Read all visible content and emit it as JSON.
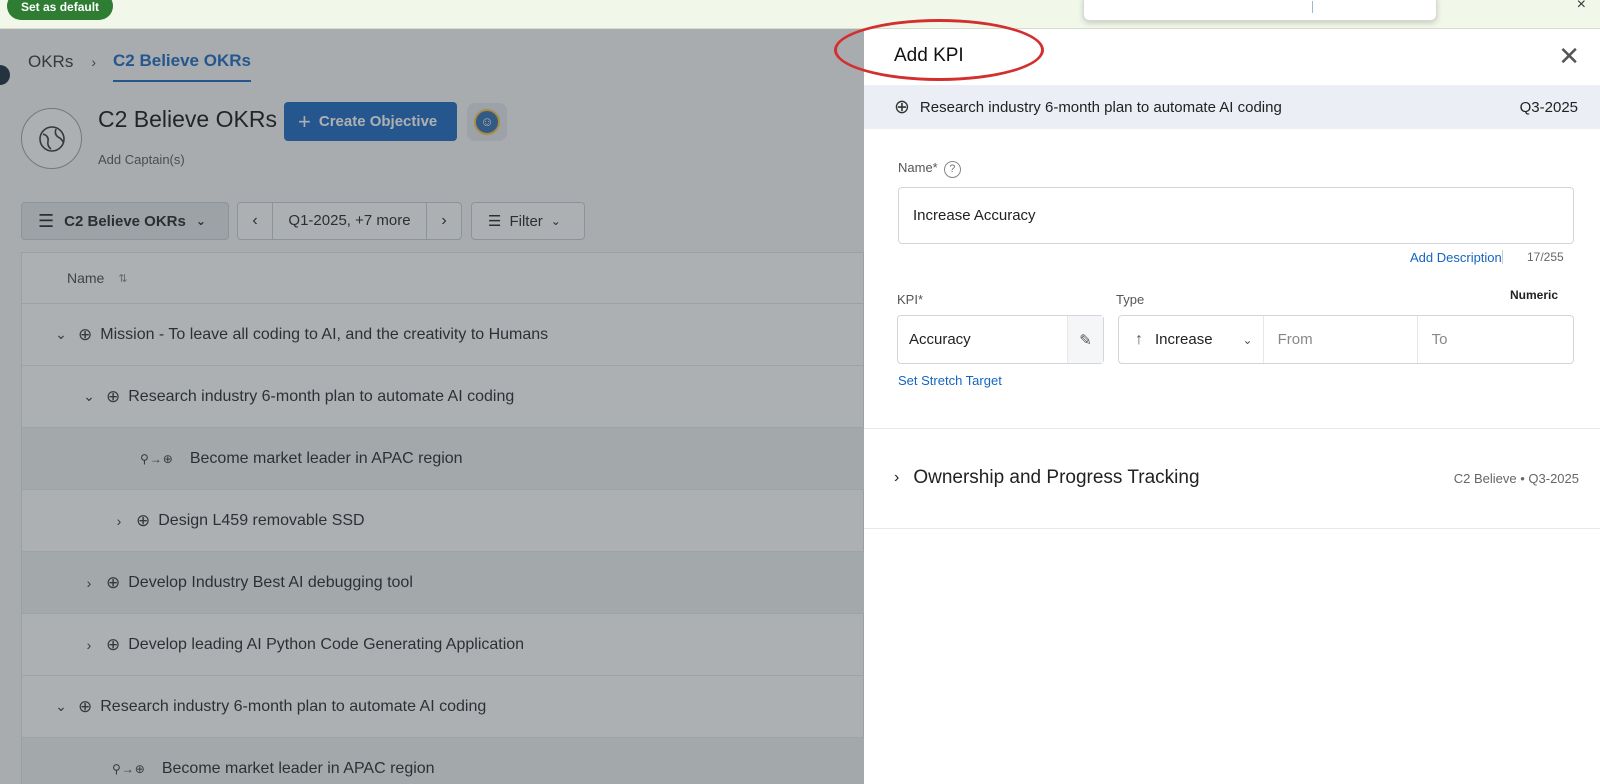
{
  "banner": {
    "default_button": "Set as default",
    "close_glyph": "×"
  },
  "breadcrumb": {
    "root": "OKRs",
    "separator": "›",
    "current": "C2 Believe OKRs"
  },
  "team": {
    "title": "C2 Believe OKRs",
    "create_button": "Create Objective",
    "create_icon": "plus-icon",
    "add_captains": "Add Captain(s)",
    "avatar_icon": "globe-icon"
  },
  "toolbar": {
    "okr_selector": "C2 Believe OKRs",
    "period": "Q1-2025, +7 more",
    "filter": "Filter"
  },
  "table": {
    "column_name": "Name",
    "rows": [
      {
        "text": "Mission - To leave all coding to AI, and the creativity to Humans",
        "caret": "⌄",
        "kind": "objective"
      },
      {
        "text": "Research industry 6-month plan to automate AI coding",
        "caret": "⌄",
        "kind": "objective"
      },
      {
        "text": "Become market leader in APAC region",
        "caret": "",
        "kind": "key-result"
      },
      {
        "text": "Design L459 removable SSD",
        "caret": "›",
        "kind": "objective"
      },
      {
        "text": "Develop Industry Best AI debugging tool",
        "caret": "›",
        "kind": "objective"
      },
      {
        "text": "Develop leading AI Python Code Generating Application",
        "caret": "›",
        "kind": "objective"
      },
      {
        "text": "Research industry 6-month plan to automate AI coding",
        "caret": "⌄",
        "kind": "objective"
      },
      {
        "text": "Become market leader in APAC region",
        "caret": "",
        "kind": "key-result"
      }
    ]
  },
  "drawer": {
    "title": "Add KPI",
    "objective": "Research industry 6-month plan to automate AI coding",
    "objective_period": "Q3-2025",
    "name_label": "Name*",
    "name_value": "Increase Accuracy",
    "add_description": "Add Description",
    "char_count": "17/255",
    "kpi_label": "KPI*",
    "kpi_value": "Accuracy",
    "type_label": "Type",
    "numeric_label": "Numeric",
    "type_value": "Increase",
    "from_placeholder": "From",
    "to_placeholder": "To",
    "stretch_target": "Set Stretch Target",
    "ownership_title": "Ownership and Progress Tracking",
    "ownership_meta": "C2 Believe  • Q3-2025"
  },
  "colors": {
    "accent": "#1565c0",
    "banner_bg": "#f1f8e9",
    "default_btn": "#2e7d32",
    "highlight_ring": "#d32f2f"
  }
}
